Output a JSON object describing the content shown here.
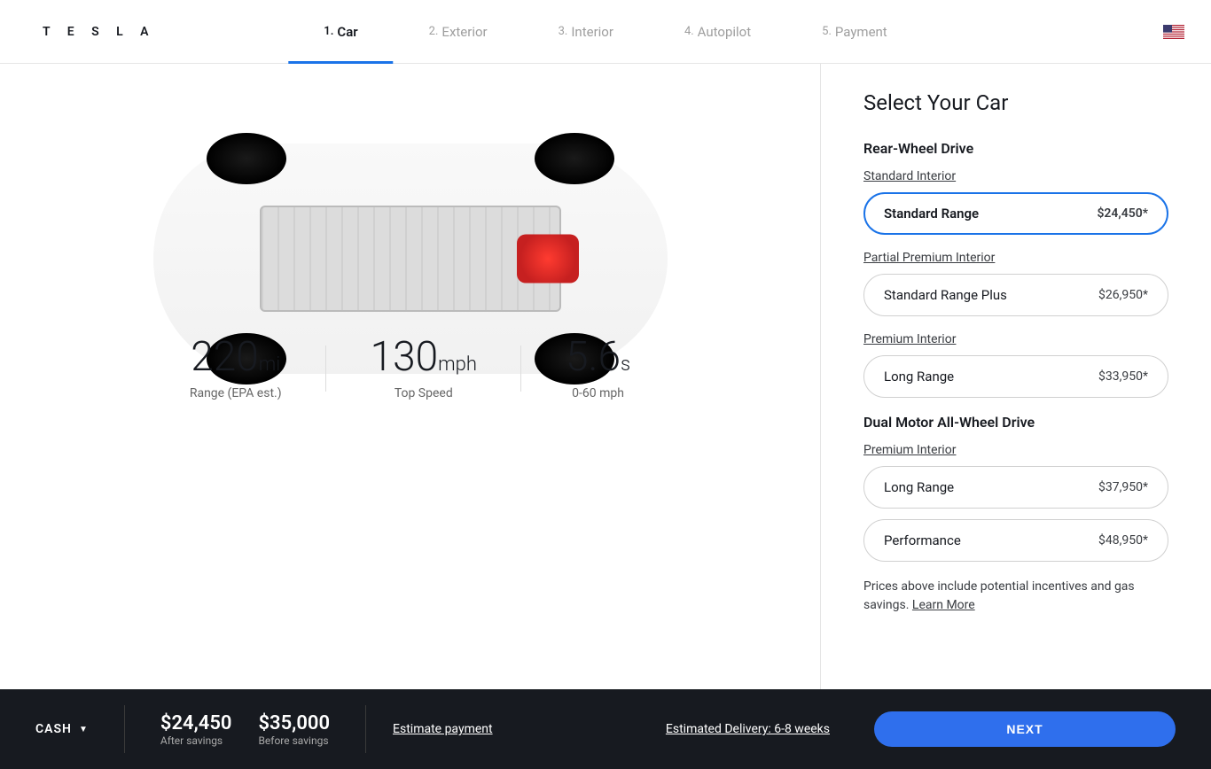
{
  "logo": "T E S L A",
  "tabs": [
    {
      "num": "1.",
      "label": "Car",
      "active": true
    },
    {
      "num": "2.",
      "label": "Exterior",
      "active": false
    },
    {
      "num": "3.",
      "label": "Interior",
      "active": false
    },
    {
      "num": "4.",
      "label": "Autopilot",
      "active": false
    },
    {
      "num": "5.",
      "label": "Payment",
      "active": false
    }
  ],
  "stats": [
    {
      "value": "220",
      "unit": "mi",
      "label": "Range (EPA est.)"
    },
    {
      "value": "130",
      "unit": "mph",
      "label": "Top Speed"
    },
    {
      "value": "5.6",
      "unit": "s",
      "label": "0-60 mph"
    }
  ],
  "panel": {
    "title": "Select Your Car",
    "groups": [
      {
        "drive": "Rear-Wheel Drive",
        "sections": [
          {
            "interior": "Standard Interior",
            "options": [
              {
                "name": "Standard Range",
                "price": "$24,450*",
                "selected": true
              }
            ]
          },
          {
            "interior": "Partial Premium Interior",
            "options": [
              {
                "name": "Standard Range Plus",
                "price": "$26,950*",
                "selected": false
              }
            ]
          },
          {
            "interior": "Premium Interior",
            "options": [
              {
                "name": "Long Range",
                "price": "$33,950*",
                "selected": false
              }
            ]
          }
        ]
      },
      {
        "drive": "Dual Motor All-Wheel Drive",
        "sections": [
          {
            "interior": "Premium Interior",
            "options": [
              {
                "name": "Long Range",
                "price": "$37,950*",
                "selected": false
              },
              {
                "name": "Performance",
                "price": "$48,950*",
                "selected": false
              }
            ]
          }
        ]
      }
    ],
    "disclaimer": "Prices above include potential incentives and gas savings.",
    "learn_more": "Learn More"
  },
  "footer": {
    "cash": "CASH",
    "after_amount": "$24,450",
    "after_label": "After savings",
    "before_amount": "$35,000",
    "before_label": "Before savings",
    "estimate": "Estimate payment",
    "delivery": "Estimated Delivery: 6-8 weeks",
    "next": "NEXT"
  }
}
